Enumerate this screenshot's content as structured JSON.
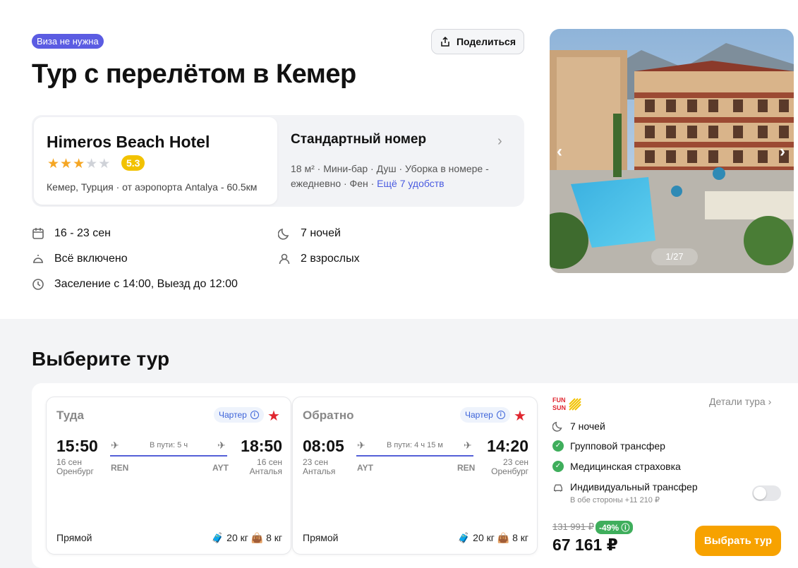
{
  "header": {
    "visa_badge": "Виза не нужна",
    "share_label": "Поделиться",
    "title": "Тур с перелётом в Кемер"
  },
  "hotel": {
    "name": "Himeros Beach Hotel",
    "stars": 3,
    "rating": "5.3",
    "location": "Кемер, Турция · от аэропорта Antalya - 60.5км"
  },
  "room": {
    "title": "Стандартный номер",
    "amenities": "18 м² · Мини-бар · Душ · Уборка в номере - ежедневно · Фен ·",
    "more_link": "Ещё 7 удобств"
  },
  "trip_info": {
    "dates": "16 - 23 сен",
    "nights": "7 ночей",
    "meals": "Всё включено",
    "guests": "2 взрослых",
    "checkin": "Заселение с 14:00, Выезд до 12:00"
  },
  "gallery": {
    "counter": "1/27"
  },
  "section_title": "Выберите тур",
  "flights": {
    "outbound": {
      "label": "Туда",
      "charter": "Чартер",
      "dep_time": "15:50",
      "dep_date": "16 сен",
      "dep_city": "Оренбург",
      "arr_time": "18:50",
      "arr_date": "16 сен",
      "arr_city": "Анталья",
      "duration": "В пути: 5 ч",
      "dep_code": "REN",
      "arr_code": "AYT",
      "type": "Прямой",
      "bag": "20 кг",
      "hand": "8 кг"
    },
    "return": {
      "label": "Обратно",
      "charter": "Чартер",
      "dep_time": "08:05",
      "dep_date": "23 сен",
      "dep_city": "Анталья",
      "arr_time": "14:20",
      "arr_date": "23 сен",
      "arr_city": "Оренбург",
      "duration": "В пути: 4 ч 15 м",
      "dep_code": "AYT",
      "arr_code": "REN",
      "type": "Прямой",
      "bag": "20 кг",
      "hand": "8 кг"
    }
  },
  "offer": {
    "operator_logo_text": "FUN SUN",
    "details_link": "Детали тура",
    "nights": "7 ночей",
    "transfer": "Групповой трансфер",
    "insurance": "Медицинская страховка",
    "individual_transfer": "Индивидуальный трансфер",
    "individual_note": "В обе стороны +11 210 ₽",
    "old_price": "131 991 ₽",
    "discount": "-49%",
    "price": "67 161 ₽",
    "cta": "Выбрать тур"
  }
}
